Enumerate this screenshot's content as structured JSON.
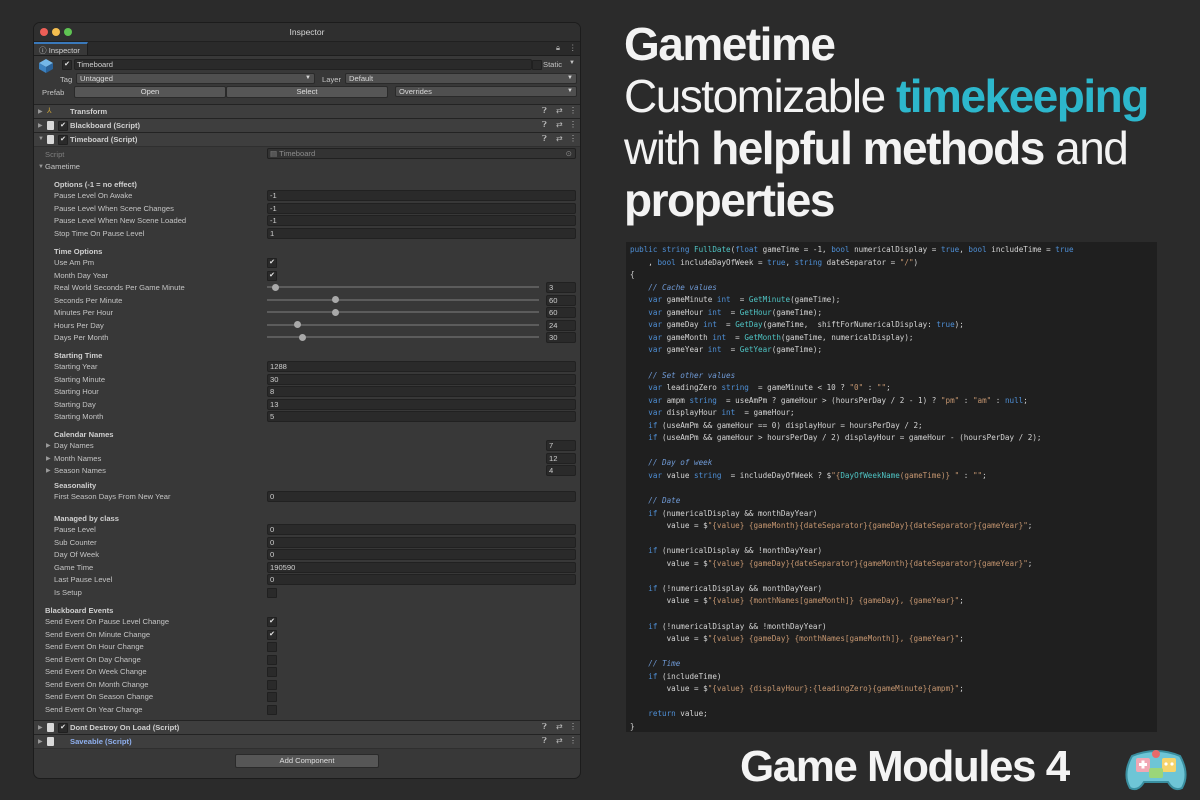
{
  "window": {
    "title": "Inspector",
    "tab": "Inspector"
  },
  "object": {
    "name": "Timeboard",
    "static_label": "Static",
    "tag_label": "Tag",
    "tag_value": "Untagged",
    "layer_label": "Layer",
    "layer_value": "Default",
    "prefab_label": "Prefab",
    "open": "Open",
    "select": "Select",
    "overrides": "Overrides"
  },
  "components": {
    "transform": "Transform",
    "blackboard": "Blackboard (Script)",
    "timeboard": "Timeboard (Script)",
    "dont_destroy": "Dont Destroy On Load (Script)",
    "saveable": "Saveable (Script)",
    "add_component": "Add Component"
  },
  "timeboard": {
    "script_label": "Script",
    "script_value": "Timeboard",
    "group": "Gametime",
    "options_header": "Options (-1 = no effect)",
    "options": [
      {
        "label": "Pause Level On Awake",
        "value": "-1"
      },
      {
        "label": "Pause Level When Scene Changes",
        "value": "-1"
      },
      {
        "label": "Pause Level When New Scene Loaded",
        "value": "-1"
      },
      {
        "label": "Stop Time On Pause Level",
        "value": "1"
      }
    ],
    "time_header": "Time Options",
    "use_am_pm": "Use Am Pm",
    "month_day_year": "Month Day Year",
    "sliders": [
      {
        "label": "Real World Seconds Per Game Minute",
        "value": "3",
        "level": 0.03
      },
      {
        "label": "Seconds Per Minute",
        "value": "60",
        "level": 0.25
      },
      {
        "label": "Minutes Per Hour",
        "value": "60",
        "level": 0.25
      },
      {
        "label": "Hours Per Day",
        "value": "24",
        "level": 0.11
      },
      {
        "label": "Days Per Month",
        "value": "30",
        "level": 0.13
      }
    ],
    "starting_header": "Starting Time",
    "starting": [
      {
        "label": "Starting Year",
        "value": "1288"
      },
      {
        "label": "Starting Minute",
        "value": "30"
      },
      {
        "label": "Starting Hour",
        "value": "8"
      },
      {
        "label": "Starting Day",
        "value": "13"
      },
      {
        "label": "Starting Month",
        "value": "5"
      }
    ],
    "calendar_header": "Calendar Names",
    "calendar": [
      {
        "label": "Day Names",
        "value": "7"
      },
      {
        "label": "Month Names",
        "value": "12"
      },
      {
        "label": "Season Names",
        "value": "4"
      }
    ],
    "seasonality_header": "Seasonality",
    "first_season": {
      "label": "First Season Days From New Year",
      "value": "0"
    },
    "managed_header": "Managed by class",
    "managed": [
      {
        "label": "Pause Level",
        "value": "0"
      },
      {
        "label": "Sub Counter",
        "value": "0"
      },
      {
        "label": "Day Of Week",
        "value": "0"
      },
      {
        "label": "Game Time",
        "value": "190590"
      },
      {
        "label": "Last Pause Level",
        "value": "0"
      }
    ],
    "is_setup": "Is Setup",
    "events_header": "Blackboard Events",
    "events": [
      {
        "label": "Send Event On Pause Level Change",
        "checked": true
      },
      {
        "label": "Send Event On Minute Change",
        "checked": true
      },
      {
        "label": "Send Event On Hour Change",
        "checked": false
      },
      {
        "label": "Send Event On Day Change",
        "checked": false
      },
      {
        "label": "Send Event On Week Change",
        "checked": false
      },
      {
        "label": "Send Event On Month Change",
        "checked": false
      },
      {
        "label": "Send Event On Season Change",
        "checked": false
      },
      {
        "label": "Send Event On Year Change",
        "checked": false
      }
    ]
  },
  "headline": {
    "line1": "Gametime",
    "line2_a": "Customizable ",
    "line2_b": "timekeeping",
    "line3_a": "with ",
    "line3_b": "helpful methods",
    "line3_c": " and",
    "line4": "properties"
  },
  "brand": "Game Modules 4",
  "colors": {
    "accent": "#2db7cc",
    "selection": "#3a79bb"
  },
  "code_lines": [
    "public string FullDate(float gameTime = -1, bool numericalDisplay = true, bool includeTime = true",
    "    , bool includeDayOfWeek = true, string dateSeparator = \"/\")",
    "{",
    "    // Cache values",
    "    var gameMinute int  = GetMinute(gameTime);",
    "    var gameHour int  = GetHour(gameTime);",
    "    var gameDay int  = GetDay(gameTime,  shiftForNumericalDisplay: true);",
    "    var gameMonth int  = GetMonth(gameTime, numericalDisplay);",
    "    var gameYear int  = GetYear(gameTime);",
    "",
    "    // Set other values",
    "    var leadingZero string  = gameMinute < 10 ? \"0\" : \"\";",
    "    var ampm string  = useAmPm ? gameHour > (hoursPerDay / 2 - 1) ? \"pm\" : \"am\" : null;",
    "    var displayHour int  = gameHour;",
    "    if (useAmPm && gameHour == 0) displayHour = hoursPerDay / 2;",
    "    if (useAmPm && gameHour > hoursPerDay / 2) displayHour = gameHour - (hoursPerDay / 2);",
    "",
    "    // Day of week",
    "    var value string  = includeDayOfWeek ? $\"{DayOfWeekName(gameTime)} \" : \"\";",
    "",
    "    // Date",
    "    if (numericalDisplay && monthDayYear)",
    "        value = $\"{value} {gameMonth}{dateSeparator}{gameDay}{dateSeparator}{gameYear}\";",
    "",
    "    if (numericalDisplay && !monthDayYear)",
    "        value = $\"{value} {gameDay}{dateSeparator}{gameMonth}{dateSeparator}{gameYear}\";",
    "",
    "    if (!numericalDisplay && monthDayYear)",
    "        value = $\"{value} {monthNames[gameMonth]} {gameDay}, {gameYear}\";",
    "",
    "    if (!numericalDisplay && !monthDayYear)",
    "        value = $\"{value} {gameDay} {monthNames[gameMonth]}, {gameYear}\";",
    "",
    "    // Time",
    "    if (includeTime)",
    "        value = $\"{value} {displayHour}:{leadingZero}{gameMinute}{ampm}\";",
    "",
    "    return value;",
    "}"
  ]
}
